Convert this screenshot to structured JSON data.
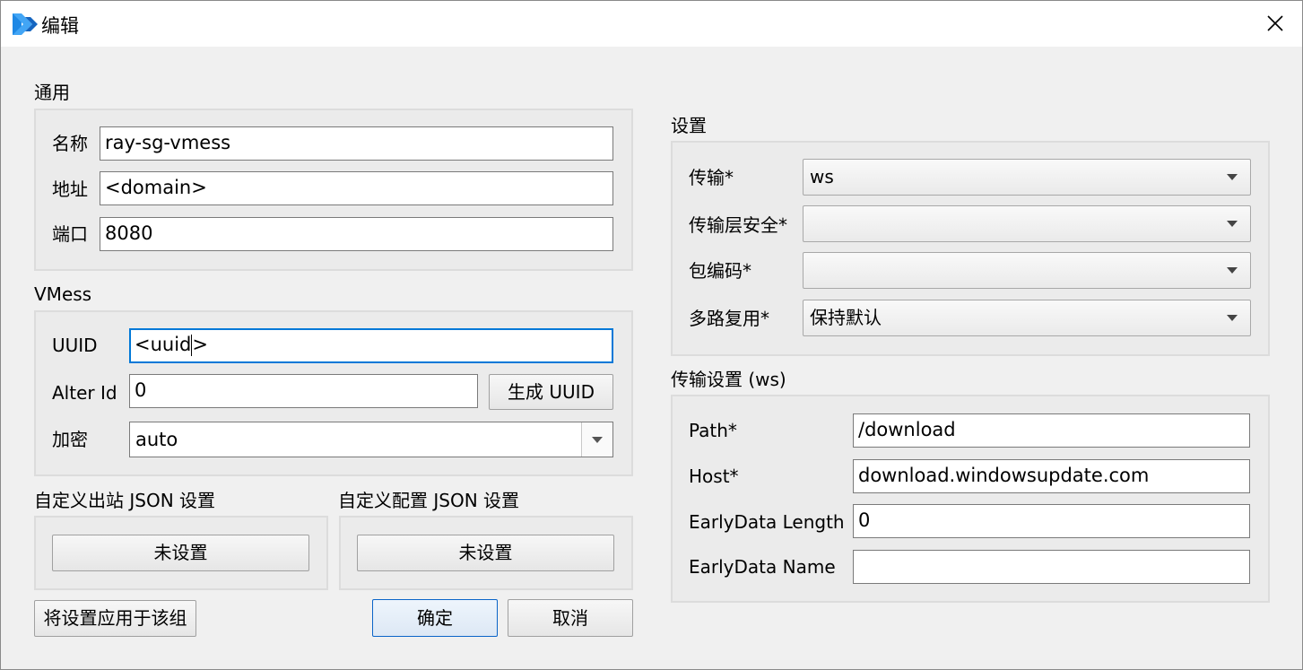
{
  "window": {
    "title": "编辑",
    "icon": "app-logo-icon",
    "close_icon": "close-icon",
    "accent": "#0078d7"
  },
  "general": {
    "title": "通用",
    "name_label": "名称",
    "name_value": "ray-sg-vmess",
    "address_label": "地址",
    "address_value": "<domain>",
    "port_label": "端口",
    "port_value": "8080"
  },
  "vmess": {
    "title": "VMess",
    "uuid_label": "UUID",
    "uuid_value_a": "<uuid",
    "uuid_value_b": ">",
    "alterid_label": "Alter Id",
    "alterid_value": "0",
    "gen_uuid_button": "生成 UUID",
    "encryption_label": "加密",
    "encryption_value": "auto"
  },
  "custom_outbound": {
    "title": "自定义出站 JSON 设置",
    "button": "未设置"
  },
  "custom_config": {
    "title": "自定义配置 JSON 设置",
    "button": "未设置"
  },
  "buttons": {
    "apply_group": "将设置应用于该组",
    "ok": "确定",
    "cancel": "取消"
  },
  "settings": {
    "title": "设置",
    "transport_label": "传输*",
    "transport_value": "ws",
    "tls_label": "传输层安全*",
    "tls_value": "",
    "packet_encoding_label": "包编码*",
    "packet_encoding_value": "",
    "mux_label": "多路复用*",
    "mux_value": "保持默认"
  },
  "transport_settings": {
    "title": "传输设置 (ws)",
    "path_label": "Path*",
    "path_value": "/download",
    "host_label": "Host*",
    "host_value": "download.windowsupdate.com",
    "earlydata_length_label": "EarlyData Length",
    "earlydata_length_value": "0",
    "earlydata_name_label": "EarlyData Name",
    "earlydata_name_value": ""
  }
}
